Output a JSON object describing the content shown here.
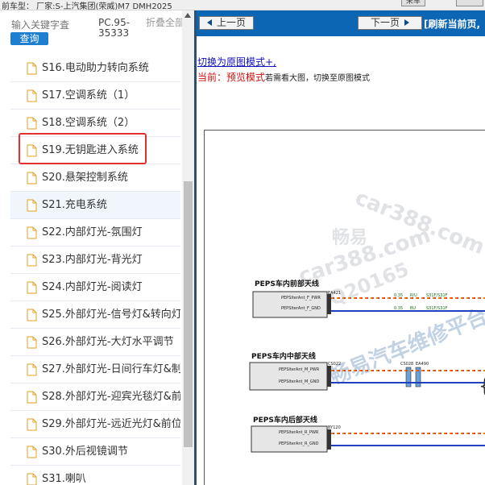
{
  "topbar": {
    "car_label": "前车型：  厂家:S-上汽集团(荣威)M7 DMH2025",
    "tab_label": "荣车"
  },
  "sidebar": {
    "search_placeholder": "输入关键字査",
    "search_button": "查询",
    "code": "PC.95-35333",
    "fold_all": "折叠全部",
    "items": [
      {
        "label": "S16.电动助力转向系统"
      },
      {
        "label": "S17.空调系统（1）"
      },
      {
        "label": "S18.空调系统（2）"
      },
      {
        "label": "S19.无钥匙进入系统"
      },
      {
        "label": "S20.悬架控制系统"
      },
      {
        "label": "S21.充电系统"
      },
      {
        "label": "S22.内部灯光-氛围灯"
      },
      {
        "label": "S23.内部灯光-背光灯"
      },
      {
        "label": "S24.内部灯光-阅读灯"
      },
      {
        "label": "S25.外部灯光-信号灯&转向灯"
      },
      {
        "label": "S26.外部灯光-大灯水平调节"
      },
      {
        "label": "S27.外部灯光-日间行车灯&制"
      },
      {
        "label": "S28.外部灯光-迎宾光毯灯&前"
      },
      {
        "label": "S29.外部灯光-远近光灯&前位"
      },
      {
        "label": "S30.外后视镜调节"
      },
      {
        "label": "S31.喇叭"
      }
    ]
  },
  "toolbar": {
    "prev_label": "上一页",
    "next_label": "下一页",
    "refresh_label": "[刷新当前页,"
  },
  "content": {
    "mode_link": "切换为原图模式+,",
    "current_prefix": "当前：",
    "current_mode": "预览模式",
    "current_hint": "若需看大图，切换至原图模式"
  },
  "diagram": {
    "front_title": "PEPS车内前部天线",
    "front_pins": [
      "PEPSIterAnt_F_PWR",
      "PEPSIterAnt_F_GND"
    ],
    "front_conn": "EA421",
    "mid_title": "PEPS车内中部天线",
    "mid_pins": [
      "PEPSIterAnt_M_PWR",
      "PEPSIterAnt_M_GND"
    ],
    "mid_conn": "CS022",
    "mid_conn2": "CS028",
    "mid_conn3": "EA490",
    "rear_title": "PEPS车内后部天线",
    "rear_pins": [
      "PEPSIterAnt_R_PWR",
      "PEPSIterAnt_R_GND"
    ],
    "rear_conn": "BY120",
    "wire_labels": [
      "0.35",
      "R/U",
      "S31F/S31F",
      "0.35",
      "BU",
      "S31F/S31F"
    ],
    "watermark_1": "car388.com",
    "watermark_2": "畅易",
    "watermark_3": "car388.com",
    "watermark_4": "QQ20165",
    "watermark_5": "畅易汽车维修平台"
  }
}
